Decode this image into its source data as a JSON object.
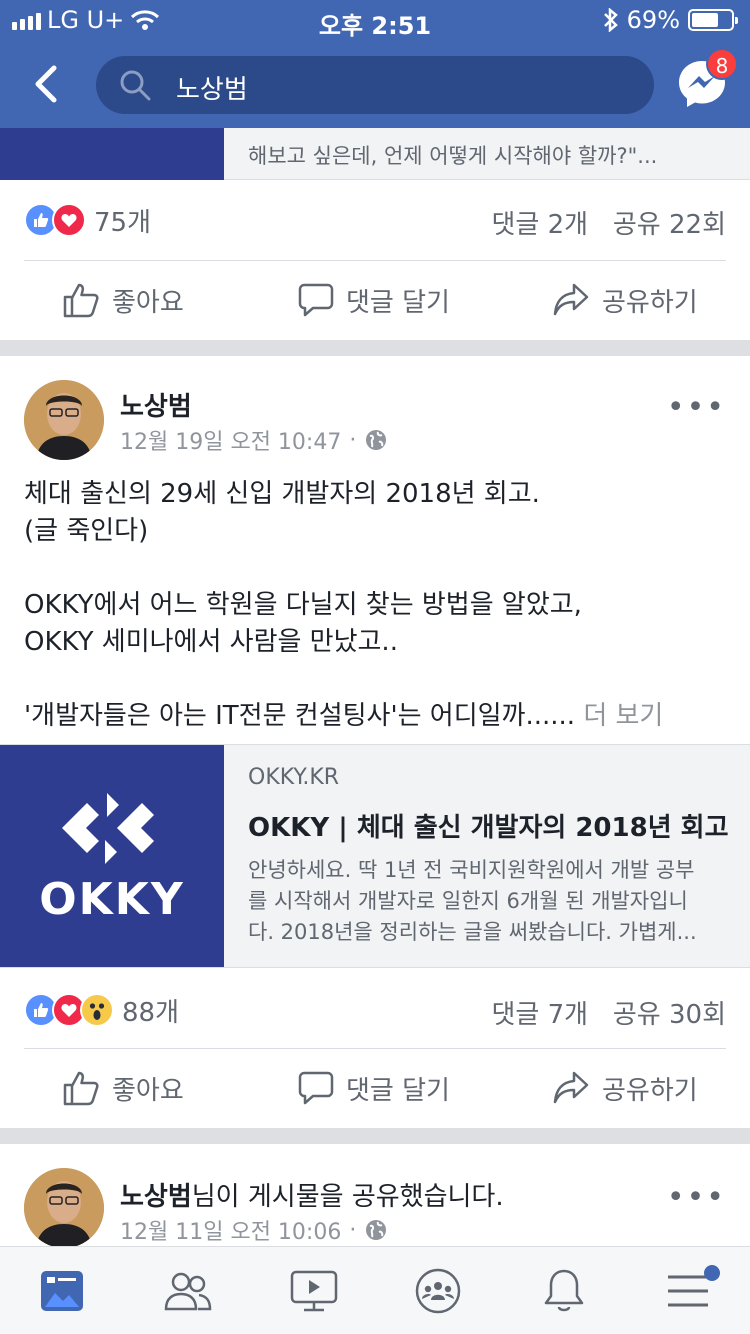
{
  "status_bar": {
    "carrier": "LG U+",
    "time": "오후 2:51",
    "battery": "69%",
    "battery_level": 0.69
  },
  "header": {
    "search_query": "노상범",
    "messenger_badge": "8"
  },
  "prev_card": {
    "link_desc_tail": "해보고 싶은데, 언제 어떻게 시작해야 할까?\"...",
    "reaction_count": "75개",
    "comments": "댓글 2개",
    "shares": "공유 22회"
  },
  "actions": {
    "like": "좋아요",
    "comment": "댓글 달기",
    "share": "공유하기"
  },
  "post": {
    "author": "노상범",
    "timestamp": "12월 19일 오전 10:47",
    "lines": [
      "체대 출신의 29세 신입 개발자의 2018년 회고.",
      "(글 죽인다)",
      "",
      "OKKY에서 어느 학원을 다닐지 찾는 방법을 알았고,",
      "OKKY 세미나에서 사람을 만났고..",
      ""
    ],
    "last_line": "'개발자들은 아는 IT전문 컨설팅사'는 어디일까......",
    "see_more": "더 보기",
    "link": {
      "logo_text": "OKKY",
      "domain": "OKKY.KR",
      "title": "OKKY | 체대 출신 개발자의 2018년 회고",
      "desc_lines": [
        "안녕하세요. 딱 1년 전 국비지원학원에서 개발 공부",
        "를 시작해서 개발자로 일한지 6개월 된 개발자입니",
        "다. 2018년을 정리하는 글을 써봤습니다. 가볍게..."
      ]
    },
    "reaction_count": "88개",
    "comments": "댓글 7개",
    "shares": "공유 30회"
  },
  "next_post": {
    "author": "노상범",
    "action_text": "님이 게시물을 공유했습니다.",
    "timestamp": "12월 11일 오전 10:06"
  },
  "tabbar": {
    "items": [
      "news-feed",
      "friends",
      "watch",
      "groups",
      "notifications",
      "menu"
    ]
  },
  "colors": {
    "brand": "#4267b2",
    "okky": "#2e3d8f"
  }
}
